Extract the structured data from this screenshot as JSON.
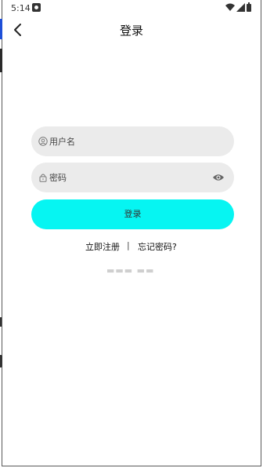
{
  "status_bar": {
    "time": "5:14",
    "icons": [
      "notification-icon",
      "wifi-icon",
      "signal-icon",
      "battery-icon"
    ]
  },
  "header": {
    "back_icon": "chevron-left-icon",
    "title": "登录"
  },
  "form": {
    "username": {
      "placeholder": "用户名",
      "value": "",
      "icon": "user-icon"
    },
    "password": {
      "placeholder": "密码",
      "value": "",
      "icon": "lock-icon",
      "toggle_icon": "eye-icon"
    },
    "login_button": "登录"
  },
  "links": {
    "register": "立即注册",
    "divider": "|",
    "forgot": "忘记密码?"
  },
  "colors": {
    "accent": "#06f5f2",
    "field_bg": "#ebebeb",
    "side_blue": "#1e4fd8"
  }
}
